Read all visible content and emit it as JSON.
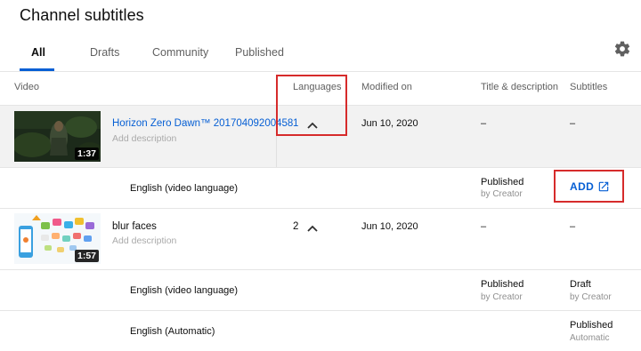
{
  "page": {
    "title": "Channel subtitles"
  },
  "tabs": [
    {
      "label": "All",
      "active": true
    },
    {
      "label": "Drafts",
      "active": false
    },
    {
      "label": "Community",
      "active": false
    },
    {
      "label": "Published",
      "active": false
    }
  ],
  "icons": {
    "settings": "gear-icon",
    "chevron": "chevron-up-icon",
    "external": "open-in-new-icon"
  },
  "columns": {
    "video": "Video",
    "languages": "Languages",
    "modified": "Modified on",
    "title_desc": "Title & description",
    "subtitles": "Subtitles"
  },
  "videos": [
    {
      "title": "Horizon Zero Dawn™ 20170409200458",
      "description": "Add description",
      "duration": "1:37",
      "languages": "1",
      "modified": "Jun 10, 2020",
      "title_desc": "–",
      "subtitles": "–",
      "tracks": [
        {
          "language": "English (video language)",
          "title_status": "Published",
          "title_by": "by Creator",
          "subtitles_action": "ADD"
        }
      ]
    },
    {
      "title": "blur faces",
      "description": "Add description",
      "duration": "1:57",
      "languages": "2",
      "modified": "Jun 10, 2020",
      "title_desc": "–",
      "subtitles": "–",
      "tracks": [
        {
          "language": "English (video language)",
          "title_status": "Published",
          "title_by": "by Creator",
          "sub_status": "Draft",
          "sub_by": "by Creator"
        },
        {
          "language": "English (Automatic)",
          "sub_status": "Published",
          "sub_by": "Automatic"
        }
      ]
    }
  ],
  "colors": {
    "accent": "#065fd4",
    "highlight": "#d62b2b",
    "row_hover": "#f2f2f2"
  }
}
